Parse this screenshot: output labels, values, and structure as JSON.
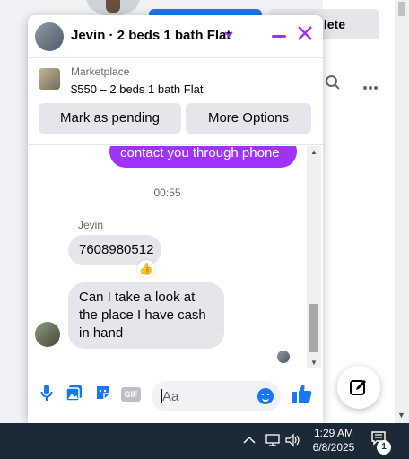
{
  "background": {
    "delete_button_label": "lete",
    "search_icon": "search-icon",
    "more_icon": "more-icon"
  },
  "chat": {
    "title": "Jevin · 2 beds 1 bath Flat",
    "marketplace_label": "Marketplace",
    "listing": "$550 – 2 beds 1 bath Flat",
    "mark_pending_label": "Mark as pending",
    "more_options_label": "More Options",
    "accent_color": "#a033ff",
    "messages": {
      "outgoing_partial": "contact you through phone",
      "timestamp": "00:55",
      "sender_name": "Jevin",
      "incoming_1": "7608980512",
      "incoming_1_reaction": "👍",
      "incoming_2": "Can I take a look at the place I have cash in hand"
    },
    "composer": {
      "placeholder": "Aa",
      "gif_label": "GIF"
    }
  },
  "taskbar": {
    "time": "1:29 AM",
    "date": "6/8/2025",
    "notification_count": "1"
  }
}
